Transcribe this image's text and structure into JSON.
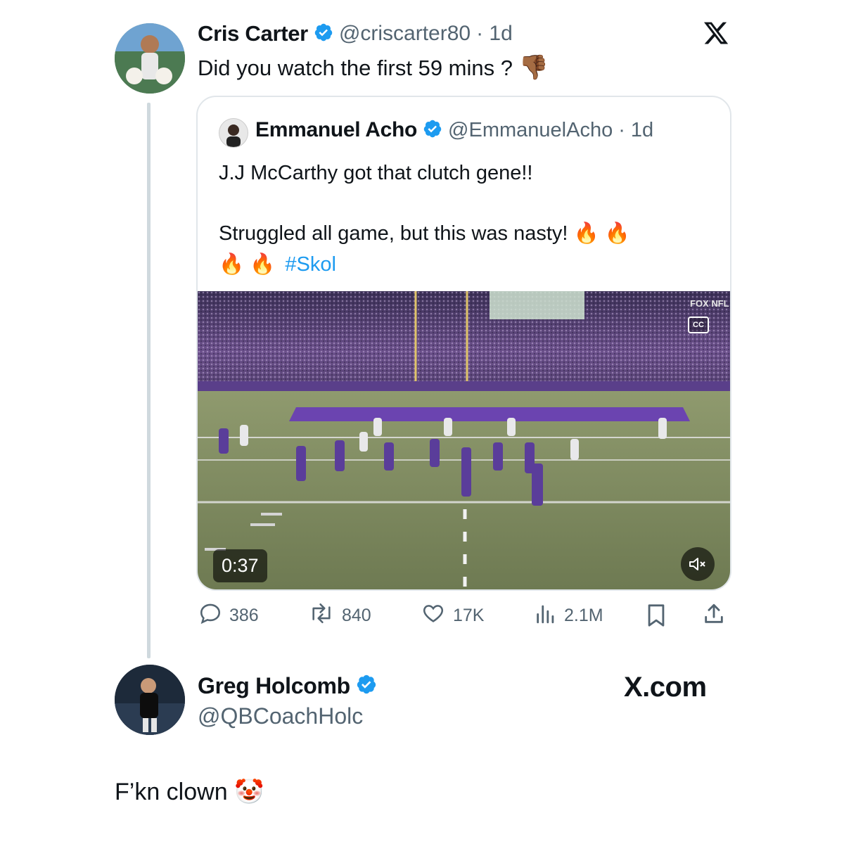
{
  "main_tweet": {
    "name": "Cris Carter",
    "handle": "@criscarter80",
    "time": "· 1d",
    "text": "Did you watch the first 59 mins ?",
    "emoji": "👎🏾"
  },
  "quoted_tweet": {
    "name": "Emmanuel Acho",
    "handle": "@EmmanuelAcho",
    "time": "· 1d",
    "line1": "J.J McCarthy got that clutch gene!!",
    "line2": "Struggled all game, but this was nasty! 🔥 🔥",
    "line3_emoji": "🔥 🔥",
    "hashtag": "#Skol",
    "video_time": "0:37",
    "video_badge": "FOX NFL",
    "cc": "CC"
  },
  "metrics": {
    "replies": "386",
    "reposts": "840",
    "likes": "17K",
    "views": "2.1M"
  },
  "reply": {
    "name": "Greg Holcomb",
    "handle": "@QBCoachHolc",
    "text": "F’kn clown 🤡"
  },
  "brand": {
    "xcom": "X.com"
  },
  "colors": {
    "verified": "#1d9bf0",
    "text": "#0f1419",
    "secondary": "#536471",
    "line": "#cfd9de",
    "link": "#1d9bf0"
  },
  "icons": [
    "x-logo-icon",
    "verified-icon",
    "reply-icon",
    "repost-icon",
    "like-icon",
    "views-icon",
    "bookmark-icon",
    "share-icon",
    "mute-icon",
    "cc-icon"
  ]
}
